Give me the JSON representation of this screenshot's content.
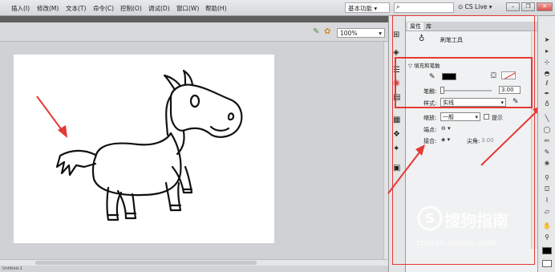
{
  "menu": {
    "items": [
      "插入(I)",
      "修改(M)",
      "文本(T)",
      "命令(C)",
      "控制(O)",
      "调试(D)",
      "窗口(W)",
      "帮助(H)"
    ],
    "workspace": "基本功能",
    "cs_live": "CS Live"
  },
  "stage": {
    "zoom": "100%",
    "status_text": "Untitled-1"
  },
  "panel": {
    "tabs": [
      "属性",
      "库"
    ],
    "tool_name": "刷笔工具",
    "section_title": "填充和笔触",
    "stroke_label": "笔触:",
    "stroke_value": "3.00",
    "style_label": "样式:",
    "style_value": "实线",
    "scale_label": "缩放:",
    "scale_value": "一般",
    "hint_label": "提示",
    "cap_label": "端点:",
    "join_label": "接合:",
    "miter_label": "尖角:",
    "miter_value": "3.00",
    "fill_color": "#000000"
  },
  "watermark": {
    "brand": "搜狗指南",
    "url": "zhinan.sogou.com"
  },
  "colors": {
    "highlight_red": "#e53935",
    "arrow_red": "#e53935"
  }
}
